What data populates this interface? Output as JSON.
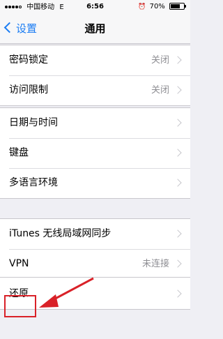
{
  "status_bar": {
    "carrier": "中国移动",
    "network": "E",
    "time": "6:56",
    "battery_percent": "70%",
    "battery_level": 0.7
  },
  "nav": {
    "back_label": "设置",
    "title": "通用"
  },
  "groups": [
    [
      {
        "label": "密码锁定",
        "value": "关闭"
      },
      {
        "label": "访问限制",
        "value": "关闭"
      }
    ],
    [
      {
        "label": "日期与时间",
        "value": ""
      },
      {
        "label": "键盘",
        "value": ""
      },
      {
        "label": "多语言环境",
        "value": ""
      }
    ],
    [
      {
        "label": "iTunes 无线局域网同步",
        "value": ""
      },
      {
        "label": "VPN",
        "value": "未连接"
      }
    ],
    [
      {
        "label": "还原",
        "value": ""
      }
    ]
  ],
  "colors": {
    "accent": "#1a7cf3",
    "annotation": "#d92128",
    "background": "#efeff4"
  }
}
